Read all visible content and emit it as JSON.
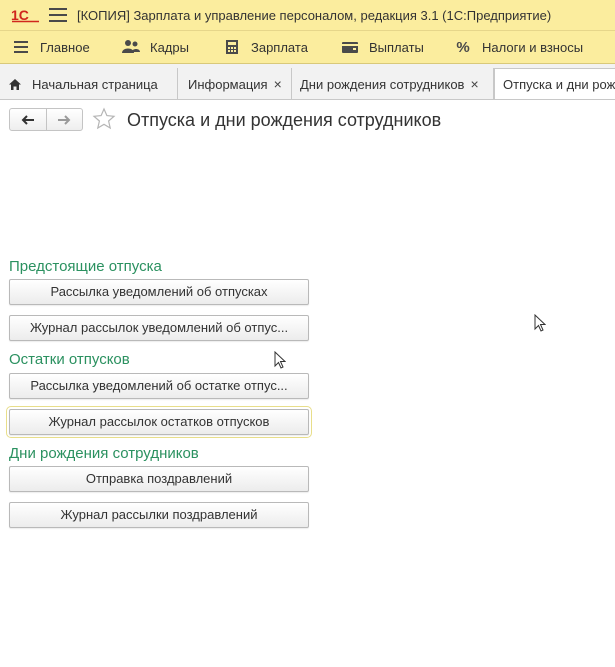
{
  "window": {
    "title": "[КОПИЯ] Зарплата и управление персоналом, редакция 3.1  (1С:Предприятие)",
    "logo_icon": "1c-logo-icon",
    "menu_icon": "hamburger-icon"
  },
  "main_menu": {
    "items": [
      {
        "label": "Главное",
        "icon": "menu-lines-icon"
      },
      {
        "label": "Кадры",
        "icon": "people-icon"
      },
      {
        "label": "Зарплата",
        "icon": "calculator-icon"
      },
      {
        "label": "Выплаты",
        "icon": "wallet-icon"
      },
      {
        "label": "Налоги и взносы",
        "icon": "percent-icon"
      }
    ]
  },
  "tabs": [
    {
      "label": "Начальная страница",
      "icon": "home-icon",
      "closable": false
    },
    {
      "label": "Информация",
      "closable": true
    },
    {
      "label": "Дни рождения сотрудников",
      "closable": true
    },
    {
      "label": "Отпуска и дни рож",
      "closable": false,
      "active": true
    }
  ],
  "close_glyph": "×",
  "page": {
    "title": "Отпуска и дни рождения сотрудников",
    "back_icon": "arrow-left-icon",
    "forward_icon": "arrow-right-icon",
    "favorite_icon": "star-icon"
  },
  "sections": [
    {
      "title": "Предстоящие отпуска",
      "buttons": [
        {
          "label": "Рассылка уведомлений об отпусках"
        },
        {
          "label": "Журнал рассылок уведомлений об отпус..."
        }
      ]
    },
    {
      "title": "Остатки отпусков",
      "buttons": [
        {
          "label": "Рассылка уведомлений об остатке отпус..."
        },
        {
          "label": "Журнал рассылок остатков отпусков",
          "focused": true
        }
      ]
    },
    {
      "title": "Дни рождения сотрудников",
      "buttons": [
        {
          "label": "Отправка поздравлений"
        },
        {
          "label": "Журнал рассылки поздравлений"
        }
      ]
    }
  ],
  "colors": {
    "header_bg": "#fbed9e",
    "section_title": "#2b9160",
    "logo_red": "#d0271d"
  }
}
